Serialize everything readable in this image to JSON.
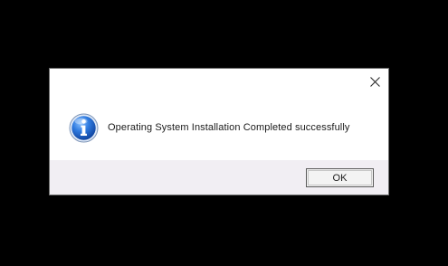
{
  "dialog": {
    "message": "Operating System Installation Completed successfully",
    "icon": "info-icon",
    "close_icon": "close-icon",
    "ok_label": "OK"
  },
  "colors": {
    "background": "#000000",
    "dialog_bg": "#ffffff",
    "footer_bg": "#f1eef3",
    "info_icon_blue": "#1f5fbf"
  }
}
